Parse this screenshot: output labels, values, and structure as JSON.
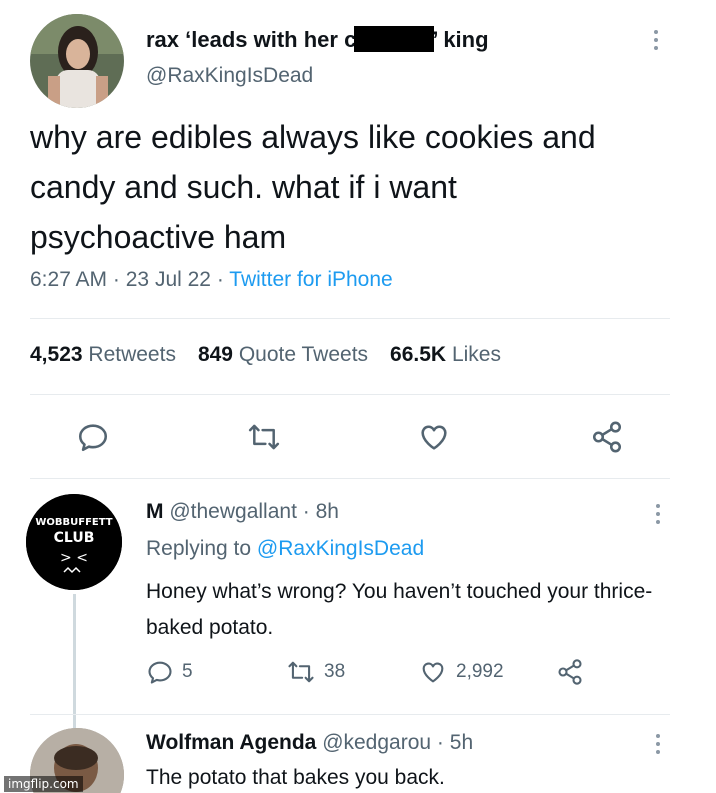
{
  "main_tweet": {
    "display_name_before": "rax ‘leads with her c",
    "display_name_after": "’ king",
    "handle": "@RaxKingIsDead",
    "text": "why are edibles always like cookies and candy and such. what if i want psychoactive ham",
    "time": "6:27 AM",
    "date": "23 Jul 22",
    "separator": "·",
    "source": "Twitter for iPhone",
    "retweets_count": "4,523",
    "retweets_label": "Retweets",
    "quotes_count": "849",
    "quotes_label": "Quote Tweets",
    "likes_count": "66.5K",
    "likes_label": "Likes",
    "icons": [
      "reply-icon",
      "retweet-icon",
      "like-icon",
      "share-icon"
    ]
  },
  "reply": {
    "name": "M",
    "handle": "@thewgallant",
    "separator": "·",
    "age": "8h",
    "replying_prefix": "Replying to",
    "replying_to": "@RaxKingIsDead",
    "text": "Honey what’s wrong? You haven’t touched your thrice-baked potato.",
    "reply_count": "5",
    "retweet_count": "38",
    "like_count": "2,992",
    "avatar_lines": [
      "WOBBUFFETT",
      "CLUB",
      ">  <"
    ]
  },
  "reply2": {
    "name": "Wolfman Agenda",
    "handle": "@kedgarou",
    "separator": "·",
    "age": "5h",
    "text": "The potato that bakes you back."
  },
  "watermark": "imgflip.com",
  "colors": {
    "text": "#0f1419",
    "secondary": "#536471",
    "link": "#1d9bf0",
    "divider": "#e7ebee"
  }
}
